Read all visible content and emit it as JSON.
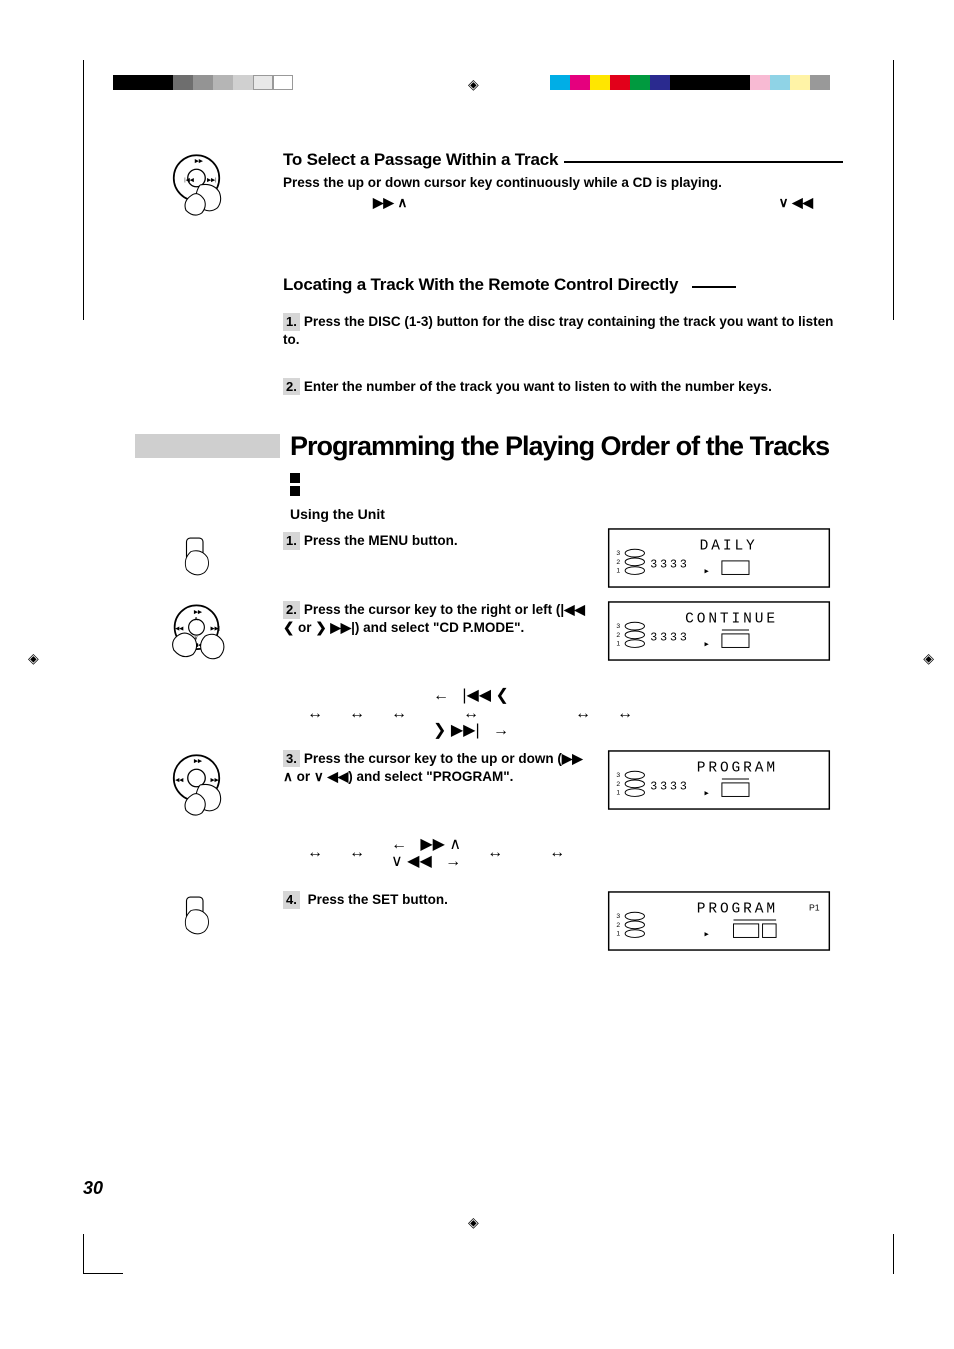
{
  "page_number": "30",
  "section1": {
    "heading": "To Select a Passage Within a Track",
    "text": "Press the up or down cursor key continuously while a CD is playing.",
    "glyphs_left": "▶▶  ∧",
    "glyphs_right": "∨  ◀◀"
  },
  "section2": {
    "heading": "Locating a Track With the Remote Control Directly",
    "steps": [
      {
        "num": "1.",
        "text": "Press the DISC (1-3) button for the disc tray containing the track you want to listen to."
      },
      {
        "num": "2.",
        "text": "Enter the number of the track you want to listen to with the number keys."
      }
    ]
  },
  "programming": {
    "heading": "Programming the Playing Order of the Tracks",
    "sub": "Using the Unit",
    "steps": [
      {
        "num": "1.",
        "text": "Press the MENU button.",
        "lcd": "DAILY"
      },
      {
        "num": "2.",
        "text": "Press the cursor key to the right or left (|◀◀ ❮ or ❯ ▶▶|) and select \"CD P.MODE\".",
        "lcd": "CONTINUE"
      },
      {
        "num": "3.",
        "text": "Press the cursor key to the up or down (▶▶ ∧ or ∨ ◀◀) and select \"PROGRAM\".",
        "lcd": "PROGRAM"
      },
      {
        "num": "4.",
        "text": " Press the SET button.",
        "lcd": "PROGRAM",
        "lcd_suffix": "P1"
      }
    ],
    "navrow1": {
      "left_arrow": "←",
      "glyph_l": "|◀◀ ❮",
      "glyph_r": "❯ ▶▶|",
      "right_arrow": "→",
      "dbl": "↔"
    },
    "navrow2": {
      "left_arrow": "←",
      "glyph_up": "▶▶ ∧",
      "glyph_dn": "∨ ◀◀",
      "right_arrow": "→",
      "dbl": "↔"
    }
  },
  "lcd_digits": "3333",
  "lcd_side": {
    "l1": "3",
    "l2": "2",
    "l3": "1"
  }
}
